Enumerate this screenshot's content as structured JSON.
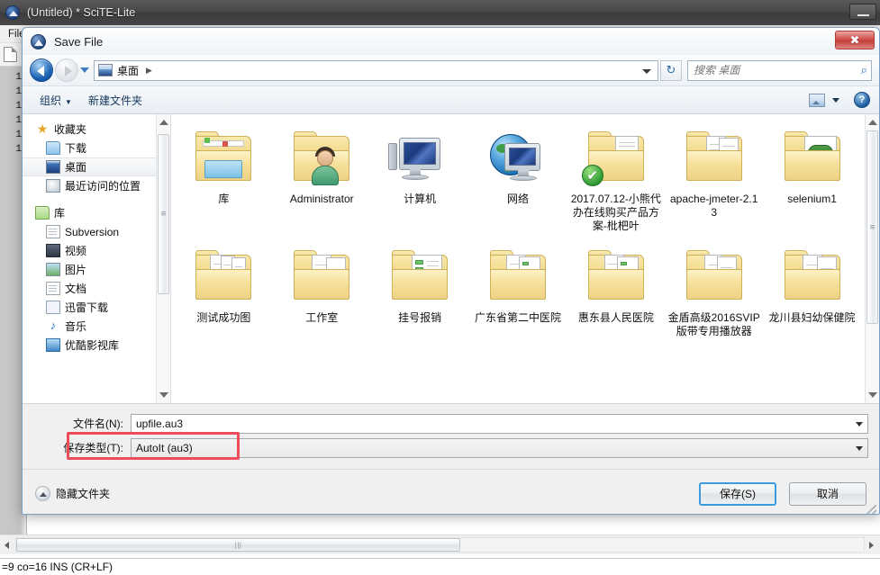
{
  "scite": {
    "title": "(Untitled) * SciTE-Lite",
    "minimize_label": "",
    "menu": [
      "File"
    ],
    "line_numbers": [
      "1",
      "1",
      "1",
      "1",
      "1",
      "1"
    ],
    "statusbar": "=9 co=16 INS (CR+LF)"
  },
  "dialog": {
    "title": "Save File",
    "close_label": "✖",
    "nav": {
      "back_label": "◀",
      "forward_label": "▶",
      "recent_label": "▾",
      "breadcrumb": "桌面",
      "breadcrumb_sep": "▶",
      "address_dropdown_label": "▾",
      "refresh_label": "↻"
    },
    "search": {
      "placeholder": "搜索 桌面",
      "value": "",
      "icon": "search-icon",
      "icon_glyph": "⌕"
    },
    "commandbar": {
      "organize": "组织",
      "organize_caret": "▼",
      "new_folder": "新建文件夹",
      "view_caret": "▼",
      "help_label": "?"
    },
    "sidebar": {
      "groups": [
        {
          "header": {
            "label": "收藏夹",
            "icon": "star-icon"
          },
          "items": [
            {
              "label": "下载",
              "icon": "download-folder-icon",
              "selected": false
            },
            {
              "label": "桌面",
              "icon": "desktop-icon",
              "selected": true
            },
            {
              "label": "最近访问的位置",
              "icon": "recent-places-icon",
              "selected": false
            }
          ]
        },
        {
          "header": {
            "label": "库",
            "icon": "library-icon"
          },
          "items": [
            {
              "label": "Subversion",
              "icon": "subversion-icon",
              "selected": false
            },
            {
              "label": "视频",
              "icon": "video-library-icon",
              "selected": false
            },
            {
              "label": "图片",
              "icon": "pictures-library-icon",
              "selected": false
            },
            {
              "label": "文档",
              "icon": "documents-library-icon",
              "selected": false
            },
            {
              "label": "迅雷下载",
              "icon": "thunder-download-icon",
              "selected": false
            },
            {
              "label": "音乐",
              "icon": "music-library-icon",
              "selected": false
            },
            {
              "label": "优酷影视库",
              "icon": "youku-library-icon",
              "selected": false
            }
          ]
        }
      ]
    },
    "files": [
      {
        "name": "库",
        "icon": "library-folder-icon"
      },
      {
        "name": "Administrator",
        "icon": "user-folder-icon"
      },
      {
        "name": "计算机",
        "icon": "computer-icon"
      },
      {
        "name": "网络",
        "icon": "network-icon"
      },
      {
        "name": "2017.07.12-小熊代办在线购买产品方案-枇杷叶",
        "icon": "folder-checked-icon"
      },
      {
        "name": "apache-jmeter-2.13",
        "icon": "folder-docs-icon"
      },
      {
        "name": "selenium1",
        "icon": "folder-selenium-icon"
      },
      {
        "name": "测试成功图",
        "icon": "folder-docs-icon"
      },
      {
        "name": "工作室",
        "icon": "folder-docs-icon"
      },
      {
        "name": "挂号报销",
        "icon": "folder-sheet-icon"
      },
      {
        "name": "广东省第二中医院",
        "icon": "folder-sheet-icon"
      },
      {
        "name": "惠东县人民医院",
        "icon": "folder-sheet-icon"
      },
      {
        "name": "金盾高级2016SVIP版带专用播放器",
        "icon": "folder-docs-icon"
      },
      {
        "name": "龙川县妇幼保健院",
        "icon": "folder-docs-icon"
      }
    ],
    "fields": {
      "filename_label": "文件名(N):",
      "filename_value": "upfile.au3",
      "filetype_label": "保存类型(T):",
      "filetype_value": "AutoIt (au3)",
      "highlight_color": "#ef4b5a"
    },
    "footer": {
      "hide_folders_label": "隐藏文件夹",
      "save_label": "保存(S)",
      "cancel_label": "取消"
    }
  }
}
